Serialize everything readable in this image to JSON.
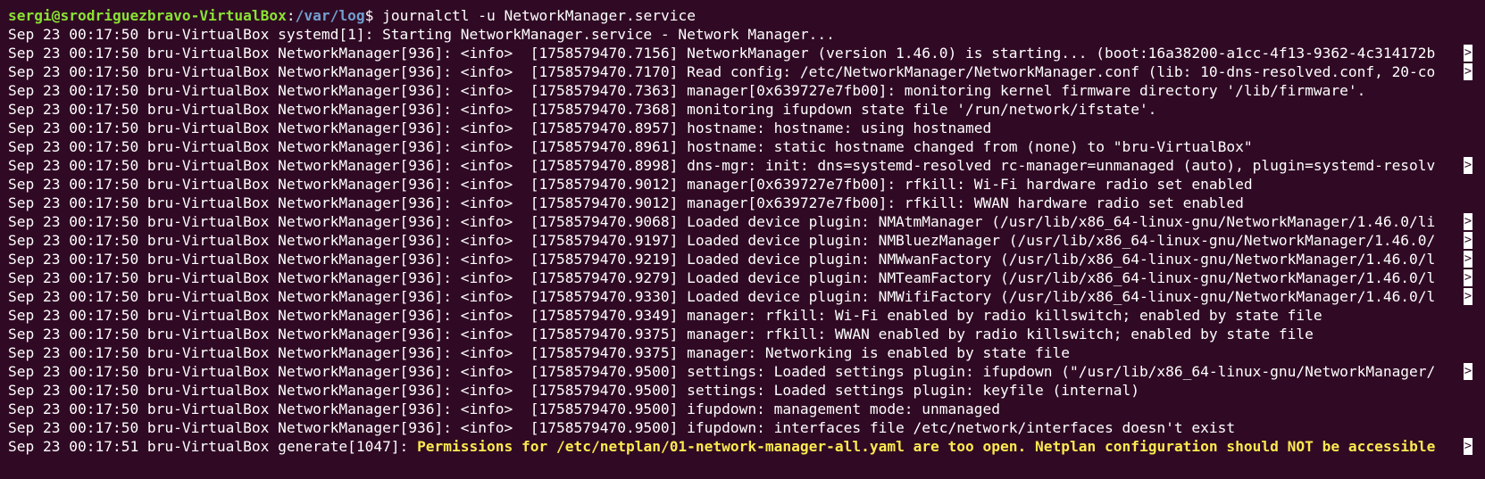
{
  "prompt": {
    "user_host": "sergi@srodriguezbravo-VirtualBox",
    "separator": ":",
    "cwd": "/var/log",
    "symbol": "$ ",
    "command": "journalctl -u NetworkManager.service"
  },
  "colors": {
    "background": "#300a24",
    "text": "#ffffff",
    "prompt_user": "#8ae234",
    "prompt_path": "#729fcf",
    "warning": "#fce94f"
  },
  "truncation_marker": ">",
  "log_lines": [
    {
      "text": "Sep 23 00:17:50 bru-VirtualBox systemd[1]: Starting NetworkManager.service - Network Manager...",
      "truncated": false
    },
    {
      "text": "Sep 23 00:17:50 bru-VirtualBox NetworkManager[936]: <info>  [1758579470.7156] NetworkManager (version 1.46.0) is starting... (boot:16a38200-a1cc-4f13-9362-4c314172b",
      "truncated": true
    },
    {
      "text": "Sep 23 00:17:50 bru-VirtualBox NetworkManager[936]: <info>  [1758579470.7170] Read config: /etc/NetworkManager/NetworkManager.conf (lib: 10-dns-resolved.conf, 20-co",
      "truncated": true
    },
    {
      "text": "Sep 23 00:17:50 bru-VirtualBox NetworkManager[936]: <info>  [1758579470.7363] manager[0x639727e7fb00]: monitoring kernel firmware directory '/lib/firmware'.",
      "truncated": false
    },
    {
      "text": "Sep 23 00:17:50 bru-VirtualBox NetworkManager[936]: <info>  [1758579470.7368] monitoring ifupdown state file '/run/network/ifstate'.",
      "truncated": false
    },
    {
      "text": "Sep 23 00:17:50 bru-VirtualBox NetworkManager[936]: <info>  [1758579470.8957] hostname: hostname: using hostnamed",
      "truncated": false
    },
    {
      "text": "Sep 23 00:17:50 bru-VirtualBox NetworkManager[936]: <info>  [1758579470.8961] hostname: static hostname changed from (none) to \"bru-VirtualBox\"",
      "truncated": false
    },
    {
      "text": "Sep 23 00:17:50 bru-VirtualBox NetworkManager[936]: <info>  [1758579470.8998] dns-mgr: init: dns=systemd-resolved rc-manager=unmanaged (auto), plugin=systemd-resolv",
      "truncated": true
    },
    {
      "text": "Sep 23 00:17:50 bru-VirtualBox NetworkManager[936]: <info>  [1758579470.9012] manager[0x639727e7fb00]: rfkill: Wi-Fi hardware radio set enabled",
      "truncated": false
    },
    {
      "text": "Sep 23 00:17:50 bru-VirtualBox NetworkManager[936]: <info>  [1758579470.9012] manager[0x639727e7fb00]: rfkill: WWAN hardware radio set enabled",
      "truncated": false
    },
    {
      "text": "Sep 23 00:17:50 bru-VirtualBox NetworkManager[936]: <info>  [1758579470.9068] Loaded device plugin: NMAtmManager (/usr/lib/x86_64-linux-gnu/NetworkManager/1.46.0/li",
      "truncated": true
    },
    {
      "text": "Sep 23 00:17:50 bru-VirtualBox NetworkManager[936]: <info>  [1758579470.9197] Loaded device plugin: NMBluezManager (/usr/lib/x86_64-linux-gnu/NetworkManager/1.46.0/",
      "truncated": true
    },
    {
      "text": "Sep 23 00:17:50 bru-VirtualBox NetworkManager[936]: <info>  [1758579470.9219] Loaded device plugin: NMWwanFactory (/usr/lib/x86_64-linux-gnu/NetworkManager/1.46.0/l",
      "truncated": true
    },
    {
      "text": "Sep 23 00:17:50 bru-VirtualBox NetworkManager[936]: <info>  [1758579470.9279] Loaded device plugin: NMTeamFactory (/usr/lib/x86_64-linux-gnu/NetworkManager/1.46.0/l",
      "truncated": true
    },
    {
      "text": "Sep 23 00:17:50 bru-VirtualBox NetworkManager[936]: <info>  [1758579470.9330] Loaded device plugin: NMWifiFactory (/usr/lib/x86_64-linux-gnu/NetworkManager/1.46.0/l",
      "truncated": true
    },
    {
      "text": "Sep 23 00:17:50 bru-VirtualBox NetworkManager[936]: <info>  [1758579470.9349] manager: rfkill: Wi-Fi enabled by radio killswitch; enabled by state file",
      "truncated": false
    },
    {
      "text": "Sep 23 00:17:50 bru-VirtualBox NetworkManager[936]: <info>  [1758579470.9375] manager: rfkill: WWAN enabled by radio killswitch; enabled by state file",
      "truncated": false
    },
    {
      "text": "Sep 23 00:17:50 bru-VirtualBox NetworkManager[936]: <info>  [1758579470.9375] manager: Networking is enabled by state file",
      "truncated": false
    },
    {
      "text": "Sep 23 00:17:50 bru-VirtualBox NetworkManager[936]: <info>  [1758579470.9500] settings: Loaded settings plugin: ifupdown (\"/usr/lib/x86_64-linux-gnu/NetworkManager/",
      "truncated": true
    },
    {
      "text": "Sep 23 00:17:50 bru-VirtualBox NetworkManager[936]: <info>  [1758579470.9500] settings: Loaded settings plugin: keyfile (internal)",
      "truncated": false
    },
    {
      "text": "Sep 23 00:17:50 bru-VirtualBox NetworkManager[936]: <info>  [1758579470.9500] ifupdown: management mode: unmanaged",
      "truncated": false
    },
    {
      "text": "Sep 23 00:17:50 bru-VirtualBox NetworkManager[936]: <info>  [1758579470.9500] ifupdown: interfaces file /etc/network/interfaces doesn't exist",
      "truncated": false
    }
  ],
  "warning_line": {
    "prefix": "Sep 23 00:17:51 bru-VirtualBox generate[1047]: ",
    "message": "Permissions for /etc/netplan/01-network-manager-all.yaml are too open. Netplan configuration should NOT be accessible",
    "truncated": true
  }
}
